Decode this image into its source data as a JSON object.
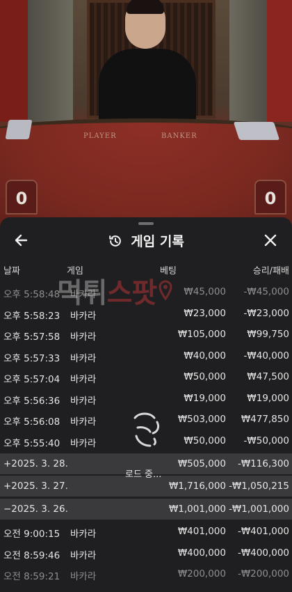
{
  "video": {
    "felt_player": "PLAYER",
    "felt_banker": "BANKER",
    "score_left": "0",
    "score_right": "0"
  },
  "sheet": {
    "title": "게임 기록",
    "icons": {
      "back": "arrow-left-icon",
      "history": "history-icon",
      "close": "close-icon"
    }
  },
  "columns": {
    "date": "날짜",
    "game": "게임",
    "bet": "베팅",
    "win": "승리/패배"
  },
  "rows": [
    {
      "date": "오후 5:58:48",
      "game": "바카라",
      "bet": "₩45,000",
      "win": "-₩45,000",
      "faded": true
    },
    {
      "date": "오후 5:58:23",
      "game": "바카라",
      "bet": "₩23,000",
      "win": "-₩23,000"
    },
    {
      "date": "오후 5:57:58",
      "game": "바카라",
      "bet": "₩105,000",
      "win": "₩99,750"
    },
    {
      "date": "오후 5:57:33",
      "game": "바카라",
      "bet": "₩40,000",
      "win": "-₩40,000"
    },
    {
      "date": "오후 5:57:04",
      "game": "바카라",
      "bet": "₩50,000",
      "win": "₩47,500"
    },
    {
      "date": "오후 5:56:36",
      "game": "바카라",
      "bet": "₩19,000",
      "win": "₩19,000"
    },
    {
      "date": "오후 5:56:08",
      "game": "바카라",
      "bet": "₩503,000",
      "win": "₩477,850"
    },
    {
      "date": "오후 5:55:40",
      "game": "바카라",
      "bet": "₩50,000",
      "win": "-₩50,000"
    },
    {
      "date": "+2025. 3. 28.",
      "game": "",
      "bet": "₩505,000",
      "win": "-₩116,300",
      "group": true
    },
    {
      "date": "+2025. 3. 27.",
      "game": "",
      "bet": "₩1,716,000",
      "win": "-₩1,050,215",
      "group": true
    },
    {
      "date": "−2025. 3. 26.",
      "game": "",
      "bet": "₩1,001,000",
      "win": "-₩1,001,000",
      "group": true
    },
    {
      "date": "오전 9:00:15",
      "game": "바카라",
      "bet": "₩401,000",
      "win": "-₩401,000"
    },
    {
      "date": "오전 8:59:46",
      "game": "바카라",
      "bet": "₩400,000",
      "win": "-₩400,000"
    },
    {
      "date": "오전 8:59:21",
      "game": "바카라",
      "bet": "₩200,000",
      "win": "-₩200,000",
      "faded": true
    }
  ],
  "watermark": {
    "part1": "먹튀",
    "part2": "스팟"
  },
  "loading": {
    "text": "로드 중..."
  }
}
